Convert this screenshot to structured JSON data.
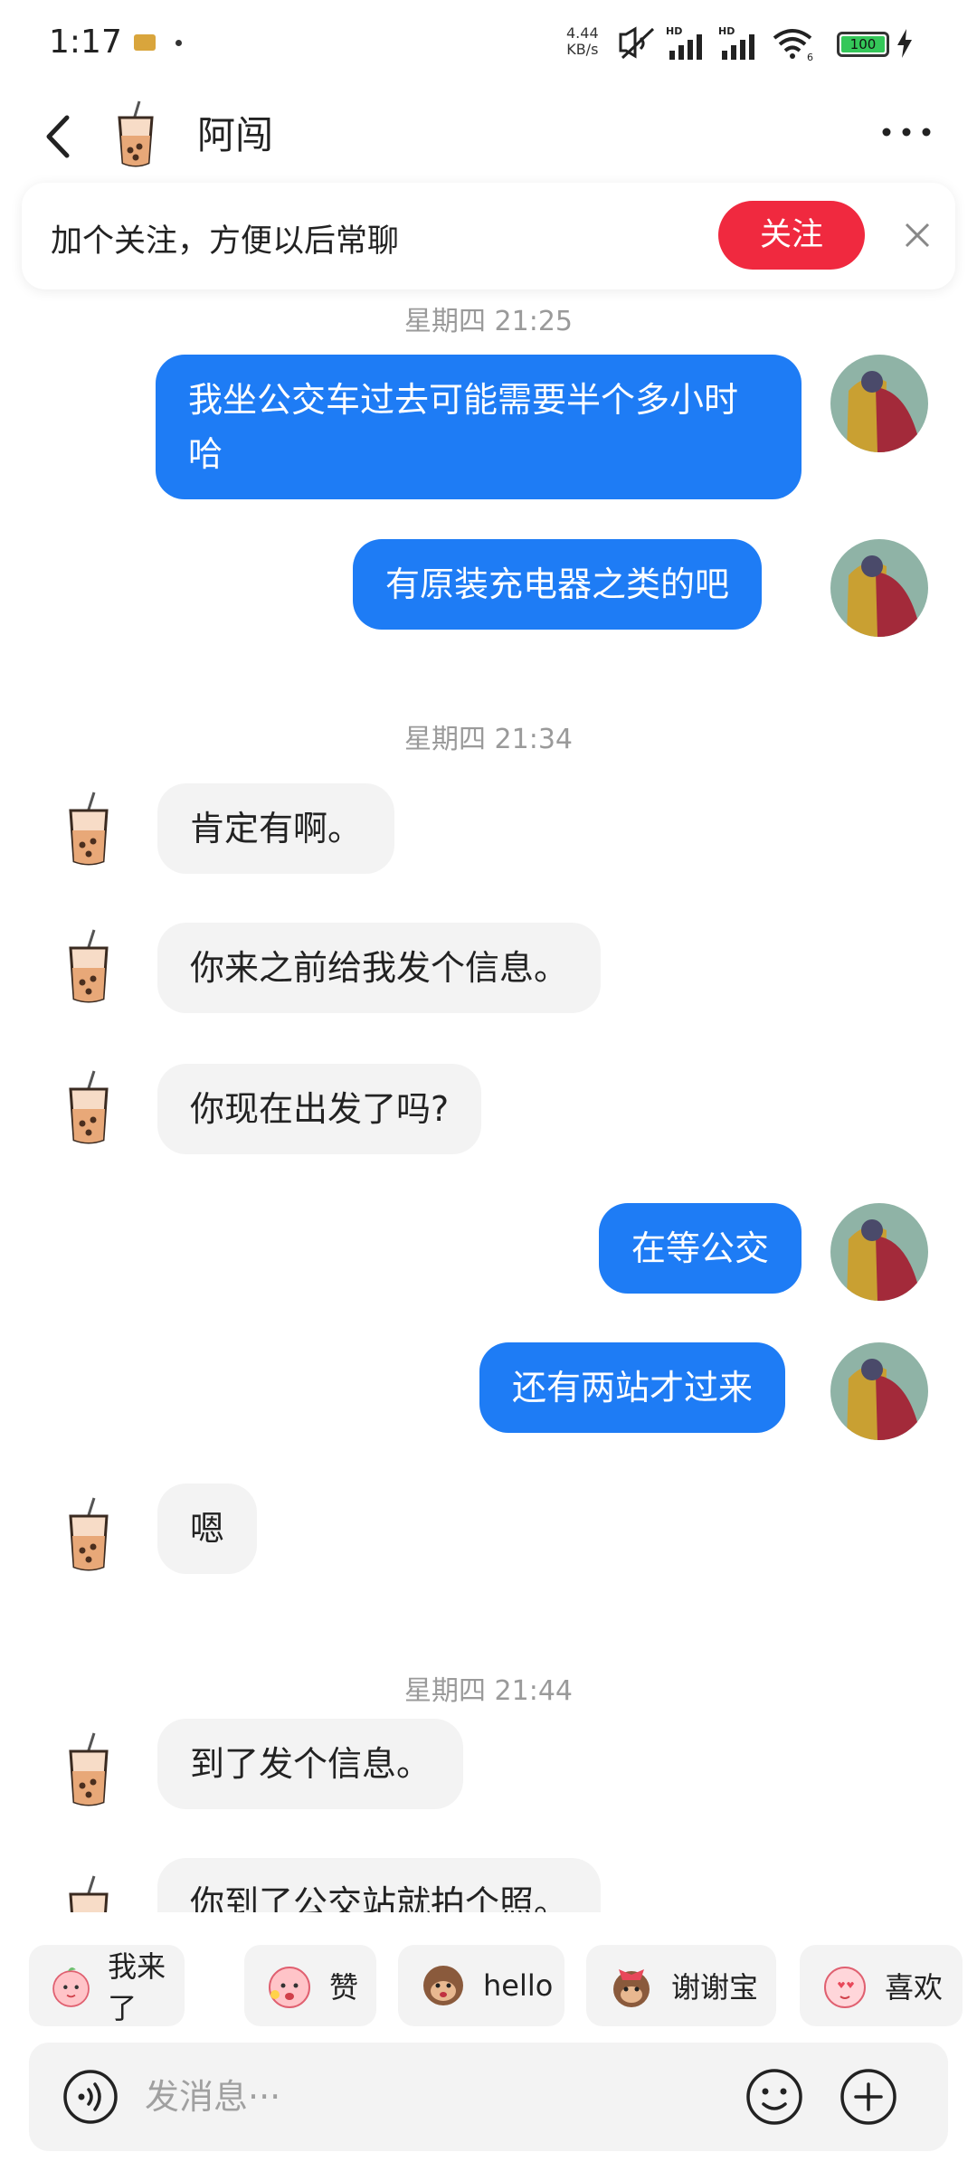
{
  "status_bar": {
    "time": "1:17",
    "speed_value": "4.44",
    "speed_unit": "KB/s",
    "battery": "100",
    "wifi_label": "6",
    "hd_label": "HD"
  },
  "header": {
    "contact_name": "阿闯"
  },
  "follow_banner": {
    "text": "加个关注，方便以后常聊",
    "button_label": "关注"
  },
  "messages": {
    "ts1": "星期四 21:25",
    "m1": "我坐公交车过去可能需要半个多小时哈",
    "m2": "有原装充电器之类的吧",
    "ts2": "星期四 21:34",
    "m3": "肯定有啊。",
    "m4": "你来之前给我发个信息。",
    "m5": "你现在出发了吗?",
    "m6": "在等公交",
    "m7": "还有两站才过来",
    "m8": "嗯",
    "ts3": "星期四 21:44",
    "m9": "到了发个信息。",
    "m10": "你到了公交站就拍个照。"
  },
  "quick_replies": [
    "我来了",
    "赞",
    "hello",
    "谢谢宝",
    "喜欢"
  ],
  "input": {
    "placeholder": "发消息···"
  },
  "colors": {
    "my_bubble": "#1e7cf5",
    "their_bubble": "#f3f3f3",
    "follow_button": "#f0293f",
    "timestamp": "#9a9a9a"
  }
}
